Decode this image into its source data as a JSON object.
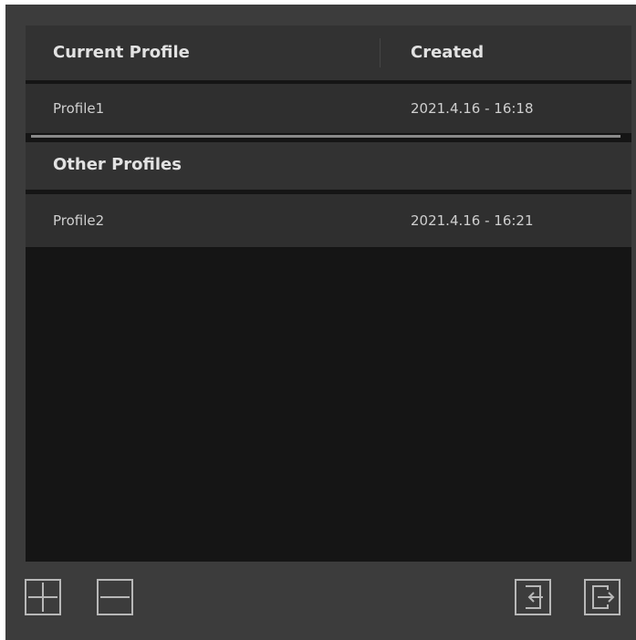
{
  "table": {
    "col_profile": "Current Profile",
    "col_created": "Created",
    "current": {
      "name": "Profile1",
      "created": "2021.4.16 - 16:18"
    },
    "other_section_label": "Other Profiles",
    "others": [
      {
        "name": "Profile2",
        "created": "2021.4.16 - 16:21"
      }
    ]
  },
  "toolbar": {
    "buttons": [
      {
        "icon": "plus-icon"
      },
      {
        "icon": "minus-icon"
      },
      {
        "icon": "import-icon"
      },
      {
        "icon": "export-icon"
      }
    ]
  },
  "colors": {
    "panel": "#3c3c3c",
    "row": "#2f2f2f",
    "list_bg": "#151515",
    "text": "#e2e2e2"
  }
}
